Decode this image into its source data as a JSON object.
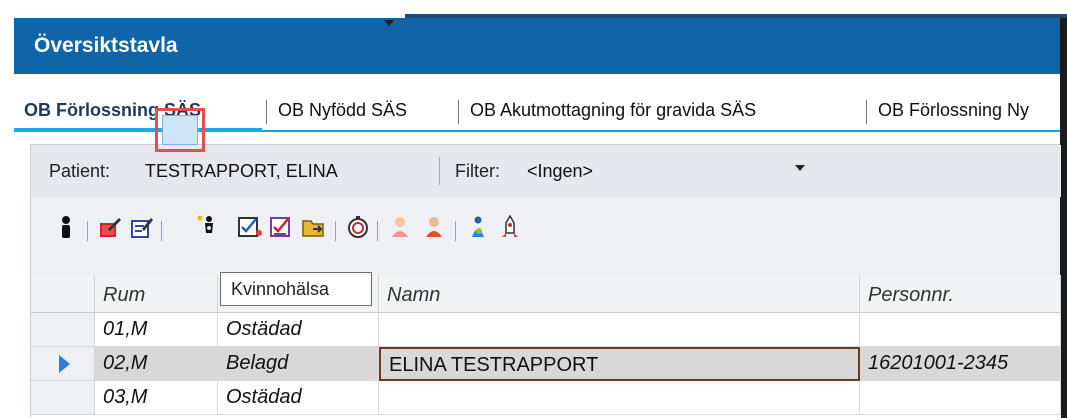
{
  "window": {
    "title": "Översiktstavla"
  },
  "tabs": [
    {
      "label": "OB Förlossning SÄS",
      "active": true
    },
    {
      "label": "OB Nyfödd SÄS",
      "active": false
    },
    {
      "label": "OB Akutmottagning för gravida SÄS",
      "active": false
    },
    {
      "label": "OB Förlossning Ny",
      "active": false
    }
  ],
  "filterbar": {
    "patient_label": "Patient:",
    "patient_value": "TESTRAPPORT, ELINA",
    "filter_label": "Filter:",
    "filter_value": "<Ingen>"
  },
  "toolbar": {
    "icons": [
      "person-icon",
      "edit-red-icon",
      "edit-form-icon",
      "kvinnohalsa-icon",
      "checklist-icon",
      "checklist-red-icon",
      "folder-icon",
      "stopwatch-icon",
      "staff-icon",
      "staff-red-icon",
      "mother-child-icon",
      "rocket-icon"
    ],
    "highlight_color": "#e05050"
  },
  "tooltip": {
    "text": "Kvinnohälsa"
  },
  "grid": {
    "columns": [
      "Rum",
      "",
      "Namn",
      "Personnr."
    ],
    "rows": [
      {
        "rum": "01,M",
        "status": "Ostädad",
        "namn": "",
        "personnr": "",
        "selected": false
      },
      {
        "rum": "02,M",
        "status": "Belagd",
        "namn": "ELINA TESTRAPPORT",
        "personnr": "16201001-2345",
        "selected": true
      },
      {
        "rum": "03,M",
        "status": "Ostädad",
        "namn": "",
        "personnr": "",
        "selected": false
      }
    ]
  },
  "colors": {
    "titlebar": "#1064a8",
    "tab_accent": "#18aaf0",
    "selection_marker": "#2a7fd4"
  }
}
